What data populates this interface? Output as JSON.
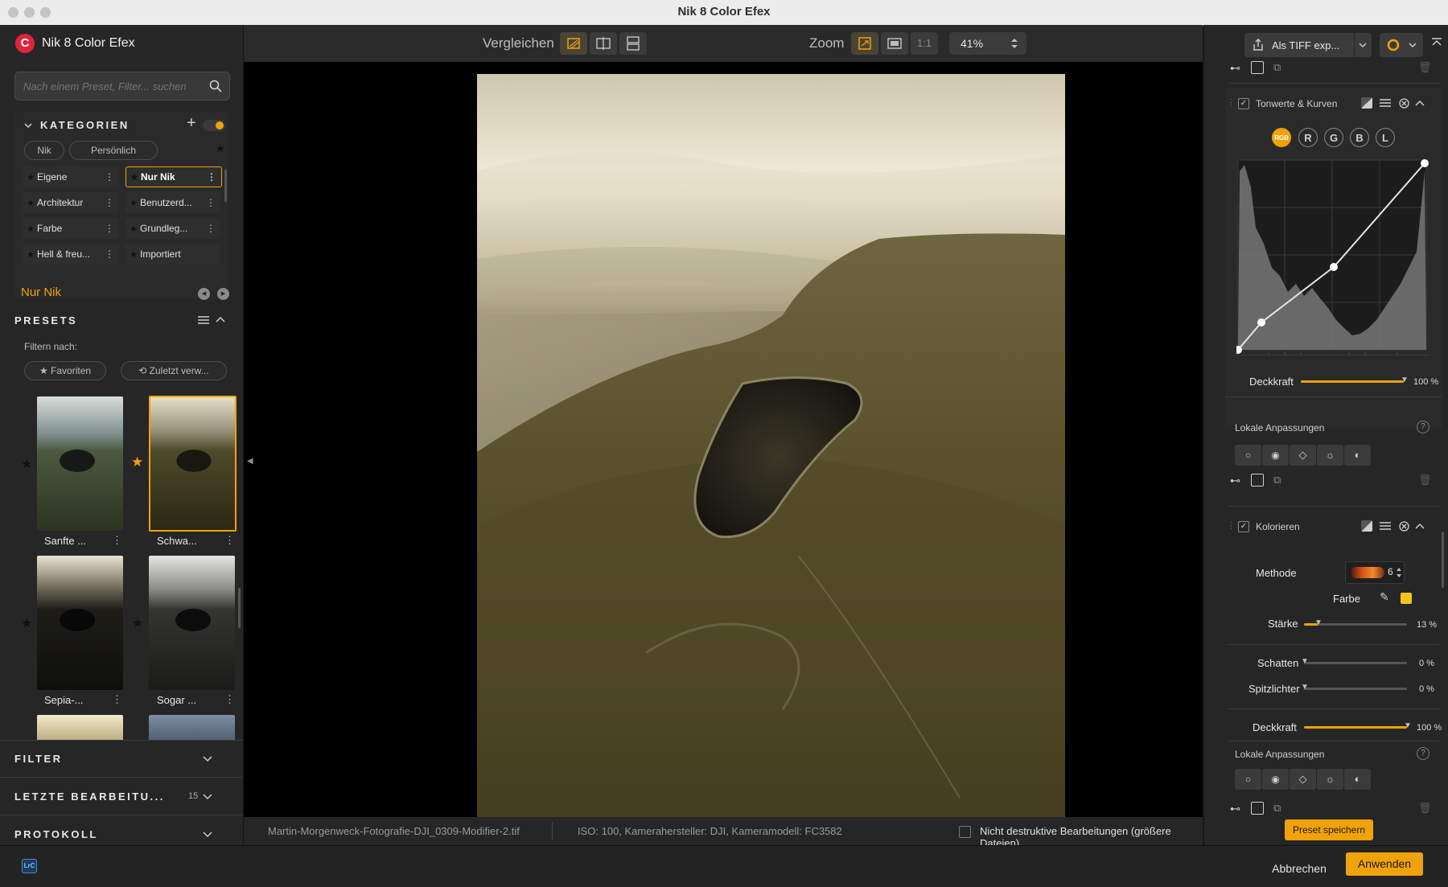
{
  "window": {
    "title": "Nik 8 Color Efex"
  },
  "app": {
    "name": "Nik 8 Color Efex"
  },
  "search": {
    "placeholder": "Nach einem Preset, Filter... suchen"
  },
  "categories": {
    "title": "KATEGORIEN",
    "chips": [
      "Nik",
      "Persönlich"
    ],
    "items": [
      {
        "label": "Eigene",
        "selected": false
      },
      {
        "label": "Nur Nik",
        "selected": true
      },
      {
        "label": "Architektur",
        "selected": false
      },
      {
        "label": "Benutzerd...",
        "selected": false
      },
      {
        "label": "Farbe",
        "selected": false
      },
      {
        "label": "Grundleg...",
        "selected": false
      },
      {
        "label": "Hell & freu...",
        "selected": false
      },
      {
        "label": "Importiert",
        "selected": false
      }
    ]
  },
  "current_category": "Nur Nik",
  "presets": {
    "title": "PRESETS",
    "filter_label": "Filtern nach:",
    "filter_chips": [
      "★ Favoriten",
      "⟲ Zuletzt verw..."
    ],
    "items": [
      {
        "label": "Sanfte ...",
        "favorite": false,
        "selected": false
      },
      {
        "label": "Schwa...",
        "favorite": true,
        "selected": true
      },
      {
        "label": "Sepia-...",
        "favorite": false,
        "selected": false
      },
      {
        "label": "Sogar ...",
        "favorite": false,
        "selected": false
      }
    ]
  },
  "sections": {
    "filter": "FILTER",
    "last_edits": "LETZTE BEARBEITU...",
    "last_edits_count": "15",
    "protocol": "PROTOKOLL"
  },
  "toolbar": {
    "compare_label": "Vergleichen",
    "zoom_label": "Zoom",
    "zoom_one_to_one": "1:1",
    "zoom_value": "41%"
  },
  "status": {
    "filename": "Martin-Morgenweck-Fotografie-DJI_0309-Modifier-2.tif",
    "meta": "ISO: 100, Kamerahersteller: DJI, Kameramodell: FC3582",
    "non_destructive": "Nicht destruktive Bearbeitungen (größere Dateien)",
    "non_destructive_checked": false
  },
  "right": {
    "export_label": "Als TIFF exp...",
    "tonwerte": {
      "title": "Tonwerte & Kurven",
      "channels": [
        "RGB",
        "R",
        "G",
        "B",
        "L"
      ],
      "active_channel": "RGB",
      "deckkraft_label": "Deckkraft",
      "deckkraft_value": "100 %",
      "deckkraft_fraction": 1.0,
      "lokale_label": "Lokale Anpassungen"
    },
    "kolorieren": {
      "title": "Kolorieren",
      "methode_label": "Methode",
      "methode_value": "6",
      "farbe_label": "Farbe",
      "farbe_color": "#f2c51a",
      "staerke_label": "Stärke",
      "staerke_value": "13 %",
      "staerke_fraction": 0.13,
      "schatten_label": "Schatten",
      "schatten_value": "0 %",
      "spitzlichter_label": "Spitzlichter",
      "spitzlichter_value": "0 %",
      "deckkraft_label": "Deckkraft",
      "deckkraft_value": "100 %",
      "deckkraft_fraction": 1.0,
      "lokale_label": "Lokale Anpassungen"
    },
    "preset_save": "Preset speichern"
  },
  "bottom": {
    "lrc_badge": "LrC",
    "cancel": "Abbrechen",
    "apply": "Anwenden"
  },
  "colors": {
    "accent": "#f0a20a",
    "brand": "#e0243b"
  }
}
